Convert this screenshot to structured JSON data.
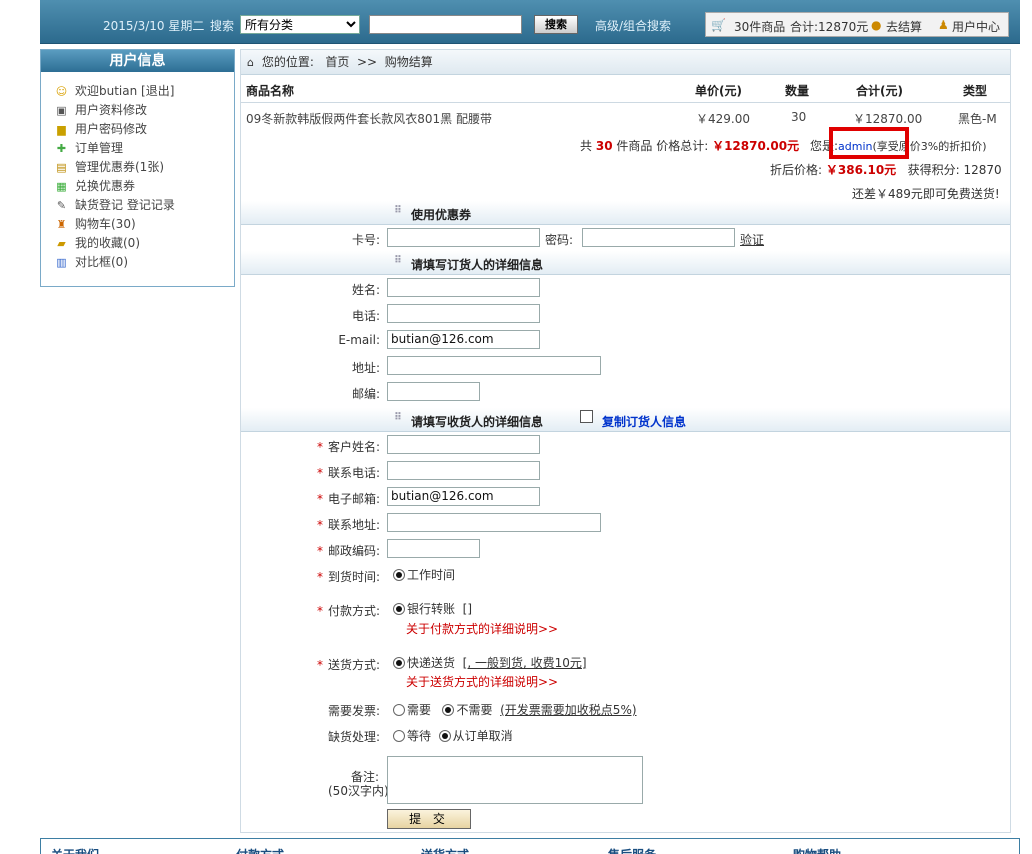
{
  "topbar": {
    "date": "2015/3/10 星期二",
    "search_label": "搜索",
    "category_selected": "所有分类",
    "search_button": "搜索",
    "advanced_search": "高级/组合搜索",
    "cart_count": "30件商品",
    "cart_total": "合计:12870元",
    "checkout": "去结算",
    "user_center": "用户中心"
  },
  "sidebar": {
    "title": "用户信息",
    "items": [
      {
        "label": "欢迎butian [退出]",
        "icon": "user-icon"
      },
      {
        "label": "用户资料修改",
        "icon": "profile-icon"
      },
      {
        "label": "用户密码修改",
        "icon": "lock-icon"
      },
      {
        "label": "订单管理",
        "icon": "order-icon"
      },
      {
        "label": "管理优惠券(1张)",
        "icon": "coupon-icon"
      },
      {
        "label": "兑换优惠券",
        "icon": "exchange-icon"
      },
      {
        "label": "缺货登记 登记记录",
        "icon": "register-icon"
      },
      {
        "label": "购物车(30)",
        "icon": "cart-icon"
      },
      {
        "label": "我的收藏(0)",
        "icon": "folder-icon"
      },
      {
        "label": "对比框(0)",
        "icon": "chart-icon"
      }
    ]
  },
  "breadcrumb": {
    "prefix": "您的位置:",
    "home": "首页",
    "sep": ">>",
    "current": "购物结算"
  },
  "table": {
    "headers": [
      "商品名称",
      "单价(元)",
      "数量",
      "合计(元)",
      "类型"
    ],
    "rows": [
      [
        "09冬新款韩版假两件套长款风衣801黑 配腰带",
        "￥429.00",
        "30",
        "￥12870.00",
        "黑色-M"
      ]
    ]
  },
  "summary": {
    "count_prefix": "共",
    "count": "30",
    "count_suffix": "件商品 价格总计:",
    "total": "￥12870.00元",
    "you_are": "您是:",
    "user": "admin",
    "discount_note": "(享受原价3%的折扣价)",
    "discounted_label": "折后价格:",
    "discounted": "￥386.10元",
    "points_label": "获得积分:",
    "points": "12870",
    "shipping_note": "还差￥489元即可免费送货!"
  },
  "coupon": {
    "title": "使用优惠券",
    "card_label": "卡号:",
    "password_label": "密码:",
    "verify": "验证"
  },
  "orderer": {
    "title": "请填写订货人的详细信息",
    "name_label": "姓名:",
    "phone_label": "电话:",
    "email_label": "E-mail:",
    "email_value": "butian@126.com",
    "address_label": "地址:",
    "zip_label": "邮编:"
  },
  "receiver": {
    "title": "请填写收货人的详细信息",
    "copy_label": "复制订货人信息",
    "name_label": "客户姓名:",
    "phone_label": "联系电话:",
    "email_label": "电子邮箱:",
    "email_value": "butian@126.com",
    "address_label": "联系地址:",
    "zip_label": "邮政编码:",
    "arrival_label": "到货时间:",
    "arrival_option": "工作时间",
    "payment_label": "付款方式:",
    "payment_option": "银行转账",
    "payment_extra": "[]",
    "payment_help": "关于付款方式的详细说明>>",
    "delivery_label": "送货方式:",
    "delivery_option": "快递送货",
    "delivery_extra": "[, 一般到货, 收费10元]",
    "delivery_help": "关于送货方式的详细说明>>",
    "invoice_label": "需要发票:",
    "invoice_yes": "需要",
    "invoice_no": "不需要",
    "invoice_note": "(开发票需要加收税点5%)",
    "stockout_label": "缺货处理:",
    "stockout_wait": "等待",
    "stockout_cancel": "从订单取消",
    "note_label": "备注:",
    "note_limit": "(50汉字内)",
    "submit": "提 交"
  },
  "footer": [
    "关于我们",
    "付款方式",
    "送货方式",
    "售后服务",
    "购物帮助"
  ]
}
